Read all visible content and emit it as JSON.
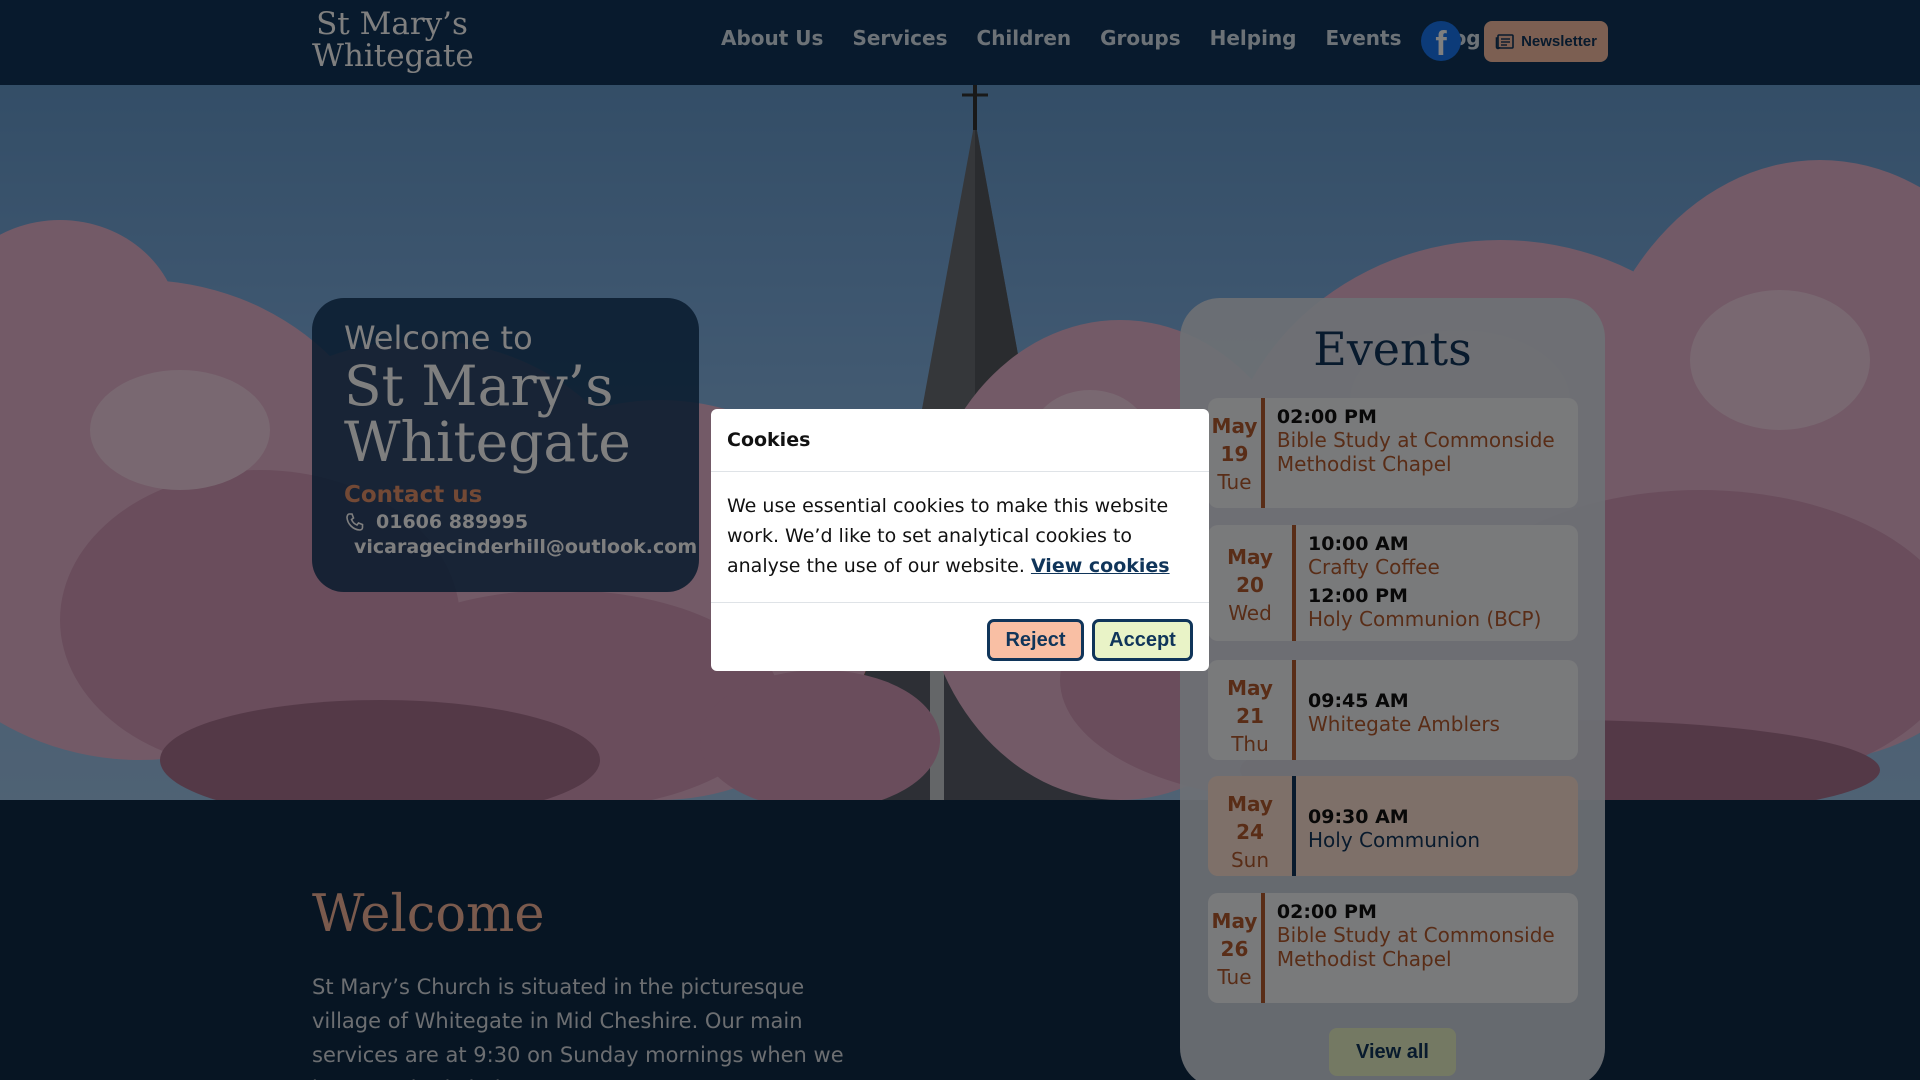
{
  "header": {
    "logo_line1": "St Mary’s",
    "logo_line2": "Whitegate",
    "nav": [
      "About Us",
      "Services",
      "Children",
      "Groups",
      "Helping",
      "Events",
      "Blog"
    ],
    "facebook_icon": "facebook-icon",
    "newsletter_label": "Newsletter",
    "newsletter_icon": "newspaper-icon"
  },
  "hero": {
    "welcome_pre": "Welcome to",
    "name_line1": "St Mary’s",
    "name_line2": "Whitegate",
    "contact_heading": "Contact us",
    "phone": "01606 889995",
    "email": "vicaragecinderhill@outlook.com"
  },
  "events": {
    "title": "Events",
    "items": [
      {
        "month": "May",
        "day": "19",
        "weekday": "Tue",
        "entries": [
          {
            "time": "02:00 PM",
            "title": "Bible Study at Commonside Methodist Chapel"
          }
        ]
      },
      {
        "month": "May",
        "day": "20",
        "weekday": "Wed",
        "entries": [
          {
            "time": "10:00 AM",
            "title": "Crafty Coffee"
          },
          {
            "time": "12:00 PM",
            "title": "Holy Communion (BCP)"
          }
        ]
      },
      {
        "month": "May",
        "day": "21",
        "weekday": "Thu",
        "entries": [
          {
            "time": "09:45 AM",
            "title": "Whitegate Amblers"
          }
        ]
      },
      {
        "month": "May",
        "day": "24",
        "weekday": "Sun",
        "entries": [
          {
            "time": "09:30 AM",
            "title": "Holy Communion"
          }
        ]
      },
      {
        "month": "May",
        "day": "26",
        "weekday": "Tue",
        "entries": [
          {
            "time": "02:00 PM",
            "title": "Bible Study at Commonside Methodist Chapel"
          }
        ]
      }
    ],
    "view_all": "View all"
  },
  "welcome": {
    "heading": "Welcome",
    "text": "St Mary’s Church is situated in the picturesque village of Whitegate in Mid Cheshire. Our main services are at 9:30 on Sunday mornings when we have a robed choir."
  },
  "cookies": {
    "title": "Cookies",
    "body": "We use essential cookies to make this website work. We’d like to set analytical cookies to analyse the use of our website.",
    "link": "View cookies",
    "reject": "Reject",
    "accept": "Accept"
  },
  "colors": {
    "navy": "#10355a",
    "peach": "#f9bfa4",
    "accent": "#b35a2f",
    "lime": "#e9f3c7"
  }
}
